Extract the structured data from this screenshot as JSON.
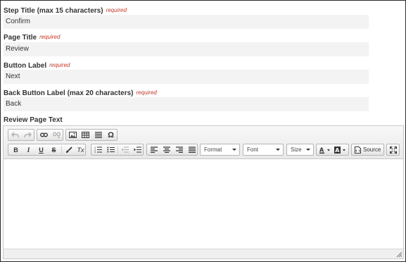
{
  "form": {
    "required_text": "required",
    "fields": [
      {
        "label": "Step Title (max 15 characters)",
        "value": "Confirm"
      },
      {
        "label": "Page Title",
        "value": "Review"
      },
      {
        "label": "Button Label",
        "value": "Next"
      },
      {
        "label": "Back Button Label (max 20 characters)",
        "value": "Back"
      }
    ],
    "review_label": "Review Page Text"
  },
  "editor": {
    "format_label": "Format",
    "font_label": "Font",
    "size_label": "Size",
    "source_label": "Source",
    "bold": "B",
    "italic": "I",
    "underline": "U",
    "strike": "S",
    "remove_format": "Tx",
    "special_char": "Ω"
  },
  "colors": {
    "required": "#c0392b",
    "field_bg": "#f3f3f3"
  }
}
